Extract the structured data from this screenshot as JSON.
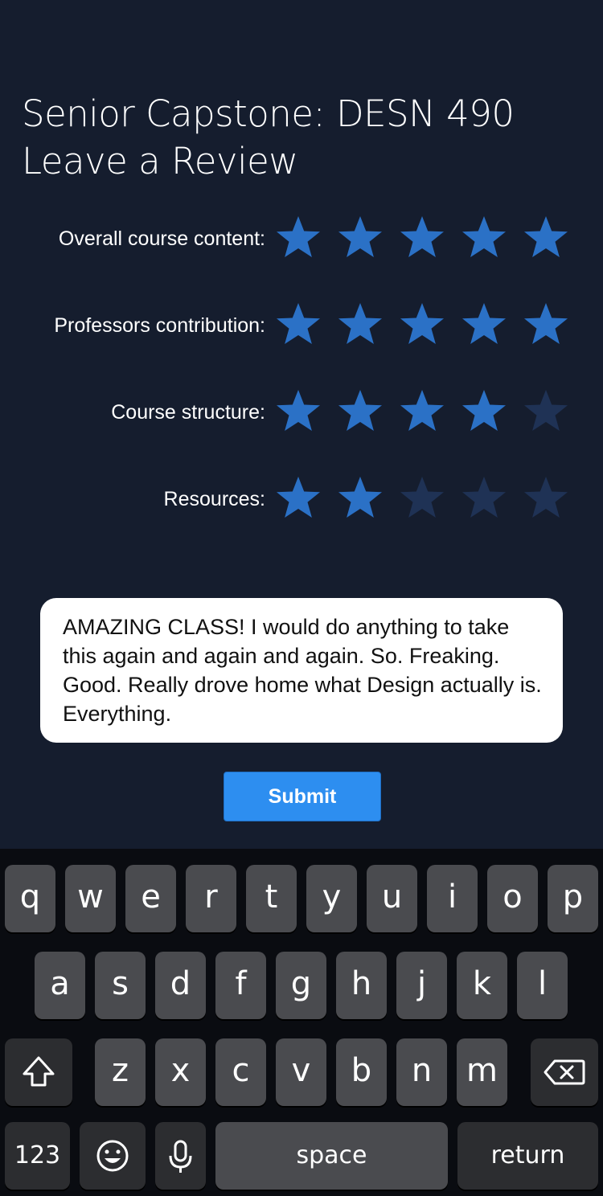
{
  "header": {
    "course_title": "Senior Capstone: DESN 490",
    "subtitle": "Leave a Review"
  },
  "ratings": [
    {
      "label": "Overall course content:",
      "value": 5,
      "max": 5
    },
    {
      "label": "Professors contribution:",
      "value": 5,
      "max": 5
    },
    {
      "label": "Course structure:",
      "value": 4,
      "max": 5
    },
    {
      "label": "Resources:",
      "value": 2,
      "max": 5
    }
  ],
  "review": {
    "text": "AMAZING CLASS! I would do anything to take this again and again and again. So. Freaking. Good. Really drove home what Design actually is. Everything."
  },
  "submit": {
    "label": "Submit"
  },
  "keyboard": {
    "row1": [
      "q",
      "w",
      "e",
      "r",
      "t",
      "y",
      "u",
      "i",
      "o",
      "p"
    ],
    "row2": [
      "a",
      "s",
      "d",
      "f",
      "g",
      "h",
      "j",
      "k",
      "l"
    ],
    "row3": [
      "z",
      "x",
      "c",
      "v",
      "b",
      "n",
      "m"
    ],
    "numbers_label": "123",
    "space_label": "space",
    "return_label": "return",
    "shift_icon": "shift-icon",
    "delete_icon": "backspace-icon",
    "emoji_icon": "emoji-icon",
    "mic_icon": "microphone-icon"
  },
  "colors": {
    "background": "#151d2e",
    "star_filled": "#2b71c6",
    "star_empty": "#1f3255",
    "submit_bg": "#2d8ef0",
    "keyboard_bg": "#0a0c11",
    "key_bg": "#4a4b4f",
    "key_dark_bg": "#2c2d30"
  }
}
